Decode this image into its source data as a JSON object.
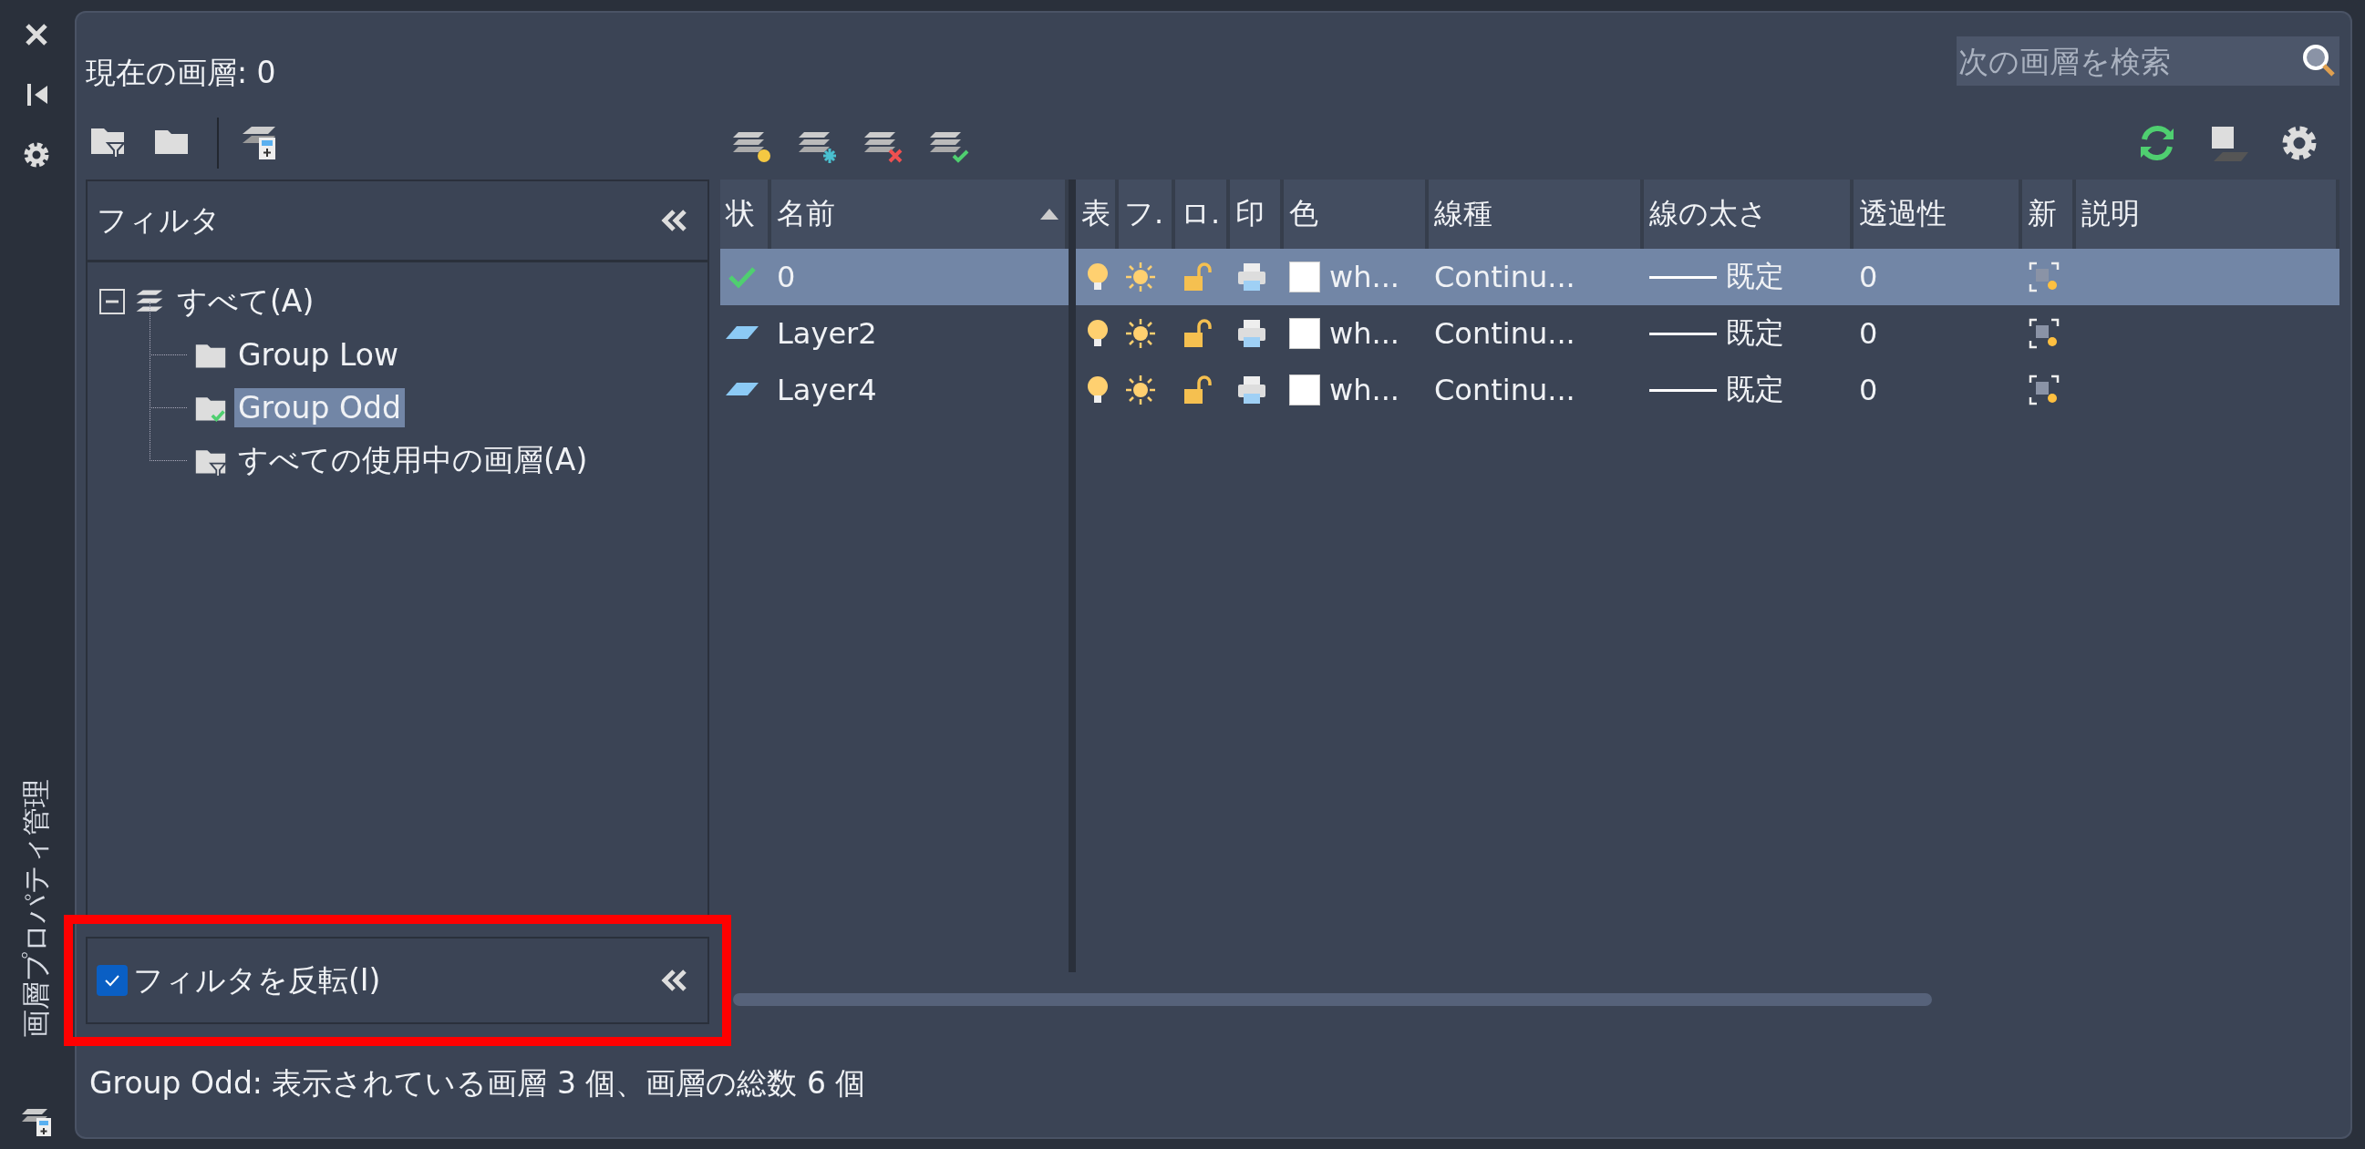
{
  "side_strip": {
    "title": "画層プロパティ管理"
  },
  "current_layer": "現在の画層: 0",
  "search": {
    "placeholder": "次の画層を検索"
  },
  "filter_panel": {
    "title": "フィルタ",
    "tree": [
      {
        "label": "すべて(A)",
        "kind": "all",
        "expanded": true,
        "selected": false,
        "children": [
          {
            "label": "Group Low",
            "kind": "group",
            "selected": false
          },
          {
            "label": "Group Odd",
            "kind": "group_applied",
            "selected": true
          },
          {
            "label": "すべての使用中の画層(A)",
            "kind": "filter",
            "selected": false
          }
        ]
      }
    ]
  },
  "invert_filter": {
    "label": "フィルタを反転(I)",
    "checked": true,
    "highlighted": true
  },
  "name_columns": [
    {
      "label": "状",
      "sorted": false
    },
    {
      "label": "名前",
      "sorted": true
    }
  ],
  "columns": [
    "表",
    "フ.",
    "ロ.",
    "印",
    "色",
    "線種",
    "線の太さ",
    "透過性",
    "新",
    "説明"
  ],
  "rows": [
    {
      "kind": "current",
      "name": "0",
      "selected": true,
      "on": true,
      "frozen": false,
      "locked": false,
      "plot": true,
      "color": "#ffffff",
      "color_name": "wh...",
      "linetype": "Continu...",
      "lineweight": "既定",
      "transparency": "0"
    },
    {
      "kind": "layer",
      "name": "Layer2",
      "selected": false,
      "on": true,
      "frozen": false,
      "locked": false,
      "plot": true,
      "color": "#ffffff",
      "color_name": "wh...",
      "linetype": "Continu...",
      "lineweight": "既定",
      "transparency": "0"
    },
    {
      "kind": "layer",
      "name": "Layer4",
      "selected": false,
      "on": true,
      "frozen": false,
      "locked": false,
      "plot": true,
      "color": "#ffffff",
      "color_name": "wh...",
      "linetype": "Continu...",
      "lineweight": "既定",
      "transparency": "0"
    }
  ],
  "status_bar": "Group Odd: 表示されている画層 3 個、画層の総数 6 個"
}
